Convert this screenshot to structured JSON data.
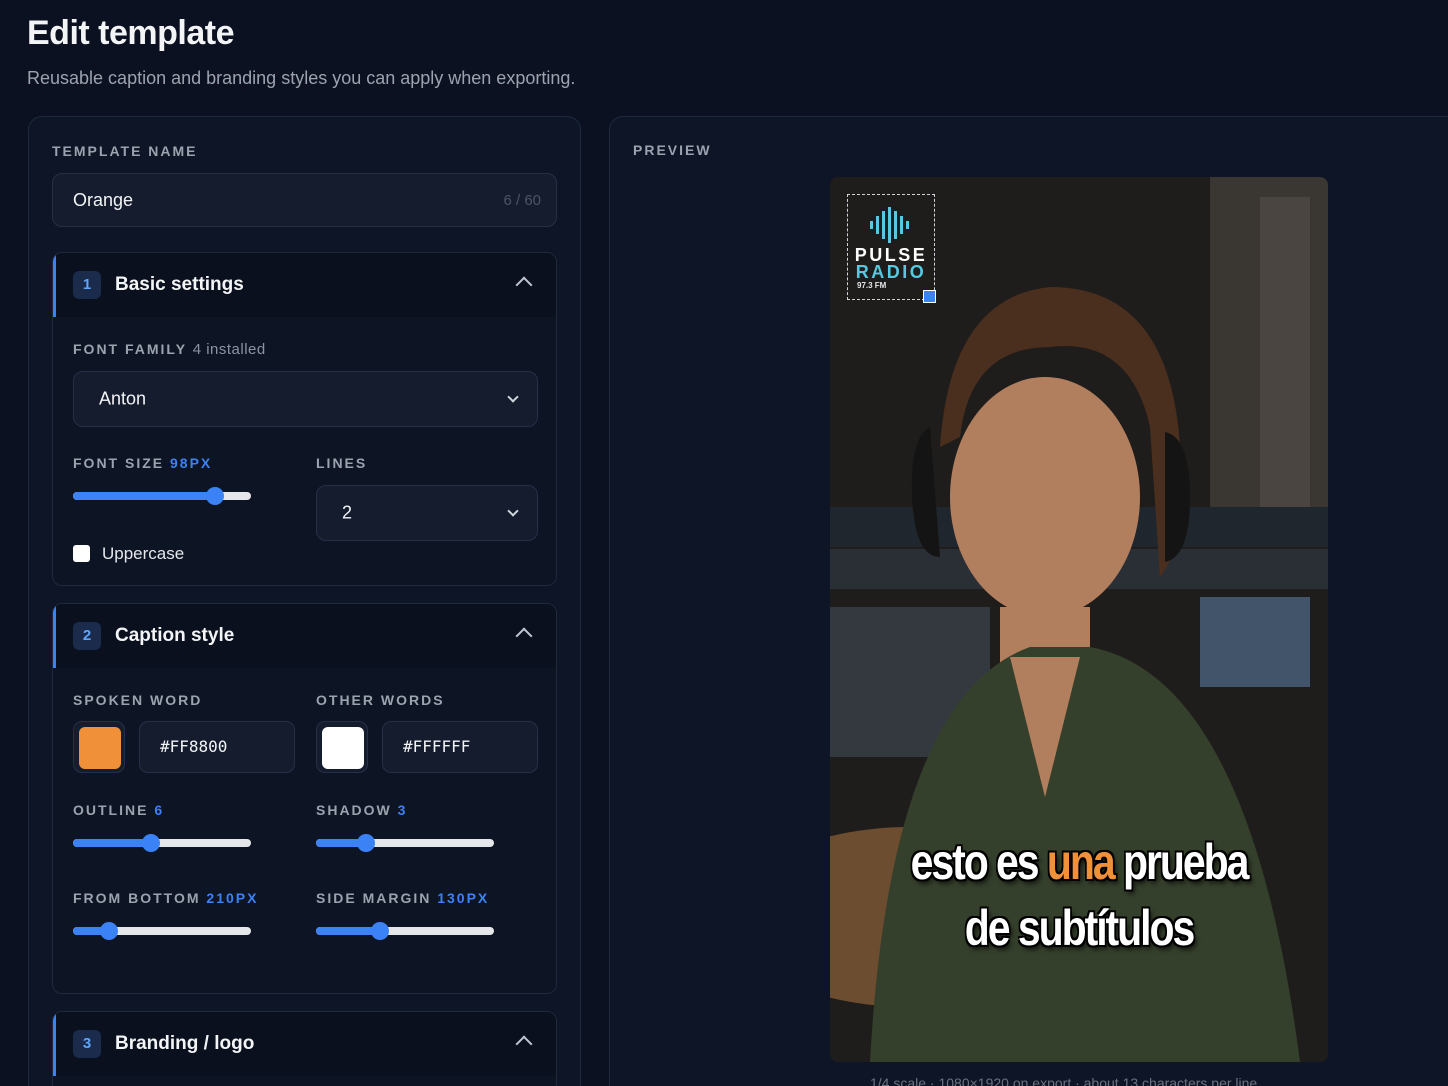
{
  "header": {
    "title": "Edit template",
    "subtitle": "Reusable caption and branding styles you can apply when exporting."
  },
  "template_name": {
    "label": "TEMPLATE NAME",
    "value": "Orange",
    "count": "6 / 60"
  },
  "sections": {
    "basic": {
      "number": "1",
      "title": "Basic settings",
      "font_family_label": "FONT FAMILY",
      "font_family_note": "4 installed",
      "font_family_value": "Anton",
      "font_size_label": "FONT SIZE",
      "font_size_value": "98PX",
      "font_size_level": 0.8,
      "lines_label": "LINES",
      "lines_value": "2",
      "uppercase_label": "Uppercase",
      "uppercase_checked": false
    },
    "caption": {
      "number": "2",
      "title": "Caption style",
      "spoken_label": "SPOKEN WORD",
      "spoken_color": "#FF8800",
      "spoken_swatch": "#f0913a",
      "other_label": "OTHER WORDS",
      "other_color": "#FFFFFF",
      "other_swatch": "#ffffff",
      "outline_label": "OUTLINE",
      "outline_value": "6",
      "outline_level": 0.44,
      "shadow_label": "SHADOW",
      "shadow_value": "3",
      "shadow_level": 0.28,
      "bottom_label": "FROM BOTTOM",
      "bottom_value": "210PX",
      "bottom_level": 0.2,
      "side_label": "SIDE MARGIN",
      "side_value": "130PX",
      "side_level": 0.36
    },
    "branding": {
      "number": "3",
      "title": "Branding / logo"
    }
  },
  "preview": {
    "label": "PREVIEW",
    "logo_line1": "PULSE",
    "logo_line2": "RADIO",
    "logo_freq": "97.3 FM",
    "caption_words_line1": [
      "esto",
      "es",
      "una",
      "prueba"
    ],
    "caption_line2": "de subtítulos",
    "highlight_index": 2,
    "footer": "1/4 scale · 1080×1920 on export · about 13 characters per line"
  }
}
